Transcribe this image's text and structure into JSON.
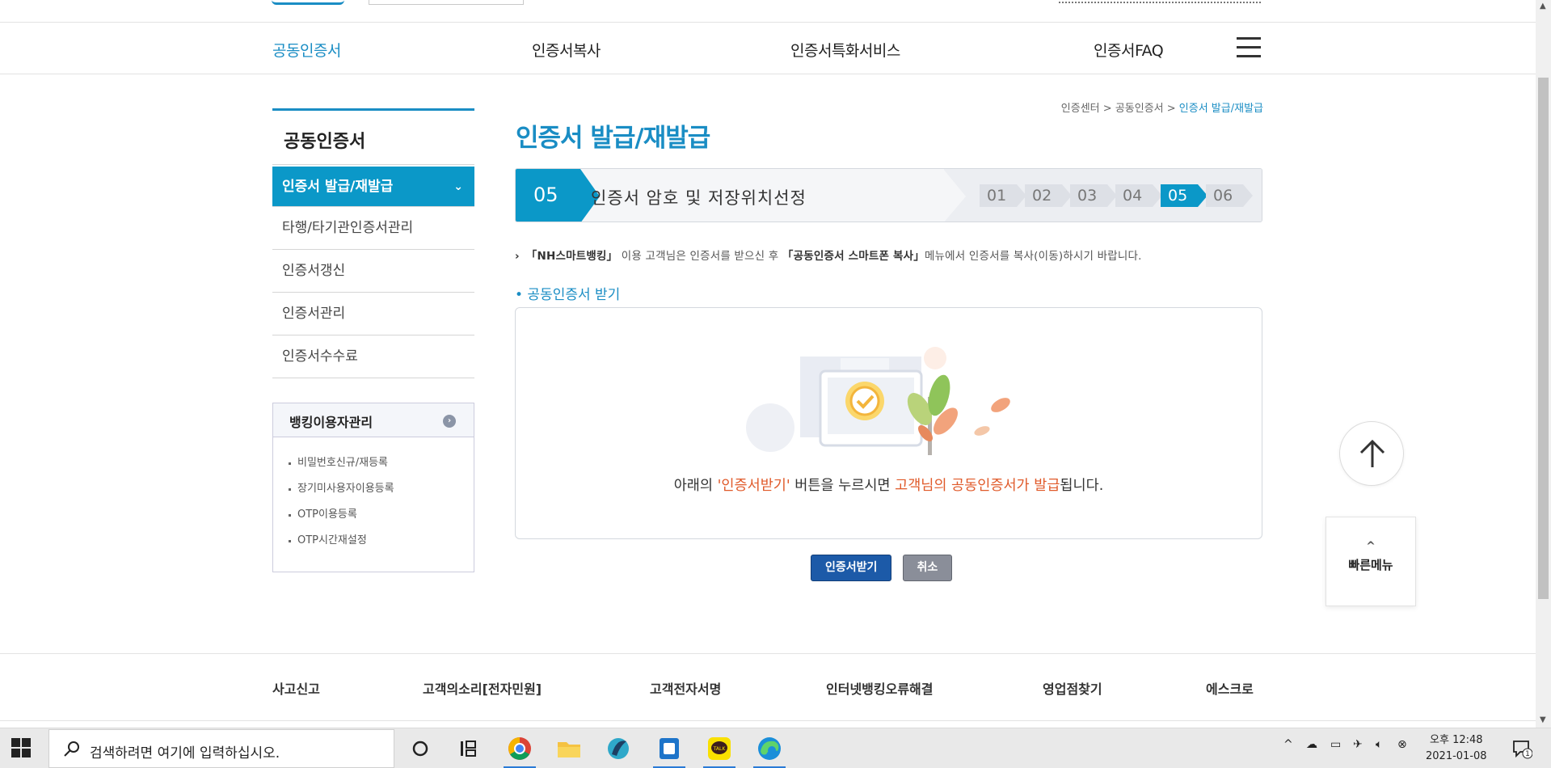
{
  "gnb": {
    "items": [
      "공동인증서",
      "인증서복사",
      "인증서특화서비스",
      "인증서FAQ"
    ]
  },
  "lnb": {
    "title": "공동인증서",
    "items": [
      "인증서 발급/재발급",
      "타행/타기관인증서관리",
      "인증서갱신",
      "인증서관리",
      "인증서수수료"
    ],
    "sub_title": "뱅킹이용자관리",
    "sub_items": [
      "비밀번호신규/재등록",
      "장기미사용자이용등록",
      "OTP이용등록",
      "OTP시간재설정"
    ]
  },
  "breadcrumb": [
    "인증센터",
    "공동인증서",
    "인증서 발급/재발급"
  ],
  "page_title": "인증서 발급/재발급",
  "stepbar": {
    "current_num": "05",
    "current_label": "인증서 암호 및 저장위치선정",
    "steps": [
      "01",
      "02",
      "03",
      "04",
      "05",
      "06"
    ],
    "active_step": "05"
  },
  "notice": {
    "prefix": "「NH스마트뱅킹」",
    "mid": " 이용 고객님은 인증서를 받으신 후 ",
    "menu": "「공동인증서 스마트폰 복사」",
    "suffix": "메뉴에서 인증서를 복사(이동)하시기 바랍니다."
  },
  "section_title": "• 공동인증서 받기",
  "cert_message": {
    "p1": "아래의 ",
    "btn_ref": "'인증서받기'",
    "p2": " 버튼을 누르시면 ",
    "highlight": "고객님의 공동인증서가 발급",
    "p3": "됩니다."
  },
  "buttons": {
    "receive": "인증서받기",
    "cancel": "취소"
  },
  "quick_menu": "빠른메뉴",
  "footer": {
    "links": [
      "사고신고",
      "고객의소리[전자민원]",
      "고객전자서명",
      "인터넷뱅킹오류해결",
      "영업점찾기",
      "에스크로"
    ]
  },
  "taskbar": {
    "search_placeholder": "검색하려면 여기에 입력하십시오.",
    "time": "오후 12:48",
    "date": "2021-01-08",
    "notif_count": "1"
  },
  "colors": {
    "brand": "#1a8dc4",
    "active_nav": "#0b98c8",
    "primary_btn": "#1c5aa8",
    "highlight": "#e05a2a"
  }
}
